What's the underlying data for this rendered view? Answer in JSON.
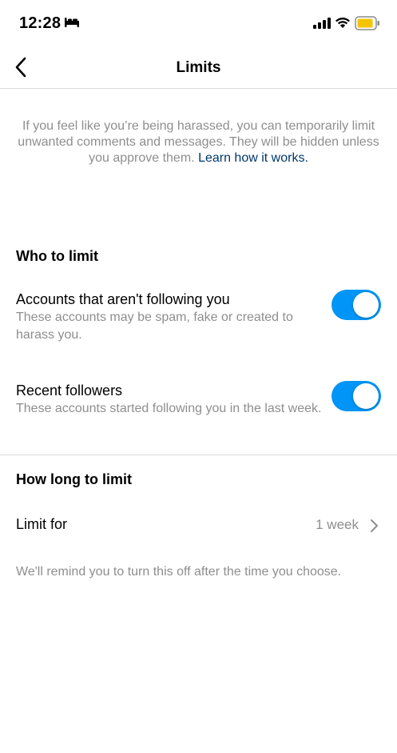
{
  "status": {
    "time": "12:28",
    "battery_color": "#f5c400"
  },
  "nav": {
    "title": "Limits"
  },
  "intro": {
    "text": "If you feel like you’re being harassed, you can temporarily limit unwanted comments and messages. They will be hidden unless you approve them.",
    "link": "Learn how it works."
  },
  "who": {
    "header": "Who to limit",
    "items": [
      {
        "title": "Accounts that aren't following you",
        "subtitle": "These accounts may be spam, fake or created to harass you.",
        "enabled": true
      },
      {
        "title": "Recent followers",
        "subtitle": "These accounts started following you in the last week.",
        "enabled": true
      }
    ]
  },
  "how_long": {
    "header": "How long to limit",
    "label": "Limit for",
    "value": "1 week",
    "reminder": "We'll remind you to turn this off after the time you choose."
  },
  "colors": {
    "accent": "#0095f6",
    "link": "#00376b",
    "secondary_text": "#8e8e8e"
  }
}
